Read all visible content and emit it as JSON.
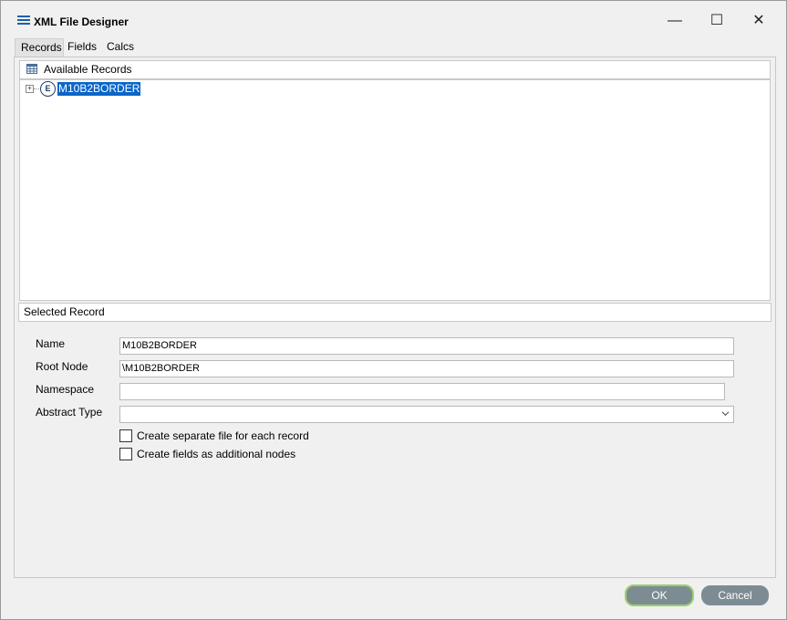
{
  "window": {
    "title": "XML File Designer",
    "minimize_glyph": "—",
    "maximize_glyph": "☐",
    "close_glyph": "✕"
  },
  "tabs": [
    {
      "label": "Records",
      "active": true
    },
    {
      "label": "Fields",
      "active": false
    },
    {
      "label": "Calcs",
      "active": false
    }
  ],
  "available_records": {
    "header": "Available Records",
    "icon": "table-icon",
    "items": [
      {
        "label": "M10B2BORDER",
        "icon_glyph": "E",
        "expander": "+",
        "selected": true
      }
    ]
  },
  "selected_record": {
    "header": "Selected Record",
    "name_label": "Name",
    "name_value": "M10B2BORDER",
    "root_node_label": "Root Node",
    "root_node_value": "\\M10B2BORDER",
    "namespace_label": "Namespace",
    "namespace_value": "",
    "abstract_type_label": "Abstract Type",
    "abstract_type_value": "",
    "checkbox_separate_file": "Create separate file for each record",
    "checkbox_separate_file_checked": false,
    "checkbox_additional_nodes": "Create fields as additional nodes",
    "checkbox_additional_nodes_checked": false
  },
  "buttons": {
    "ok": "OK",
    "cancel": "Cancel"
  },
  "colors": {
    "accent": "#0a66c8",
    "button": "#7d8c93",
    "ok_focus": "#9bd16a"
  }
}
